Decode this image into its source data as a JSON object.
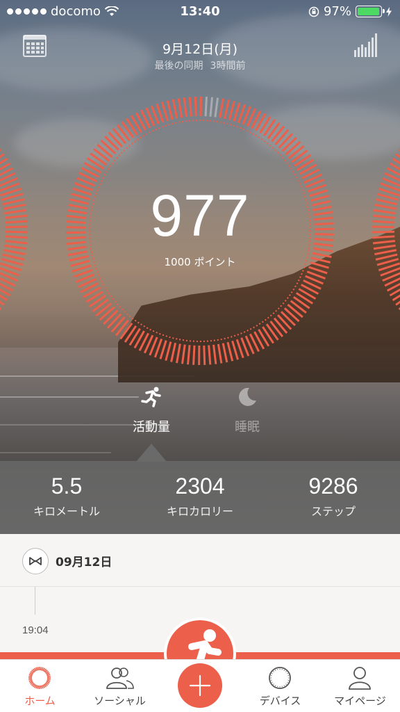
{
  "status_bar": {
    "carrier": "docomo",
    "time": "13:40",
    "battery_pct": "97%",
    "battery_level": 0.97
  },
  "header": {
    "date": "9月12日(月)",
    "sync_label": "最後の同期",
    "sync_ago": "3時間前",
    "calendar_icon": "calendar-icon",
    "chart_icon": "bar-chart-icon"
  },
  "ring": {
    "score": "977",
    "goal": "1000 ポイント",
    "progress_fraction": 0.977
  },
  "modes": {
    "activity_label": "活動量",
    "sleep_label": "睡眠",
    "activity_icon": "running-icon",
    "sleep_icon": "moon-icon"
  },
  "stats": {
    "distance_value": "5.5",
    "distance_label": "キロメートル",
    "calories_value": "2304",
    "calories_label": "キロカロリー",
    "steps_value": "9286",
    "steps_label": "ステップ"
  },
  "timeline": {
    "day_label": "09月12日",
    "day_icon": "bowtie-icon",
    "event_time": "19:04",
    "event_icon": "running-icon"
  },
  "tabbar": {
    "home": "ホーム",
    "social": "ソーシャル",
    "device": "デバイス",
    "mypage": "マイページ",
    "add_icon": "plus-icon"
  },
  "colors": {
    "accent": "#ec5f4a",
    "battery_green": "#4cd964"
  }
}
